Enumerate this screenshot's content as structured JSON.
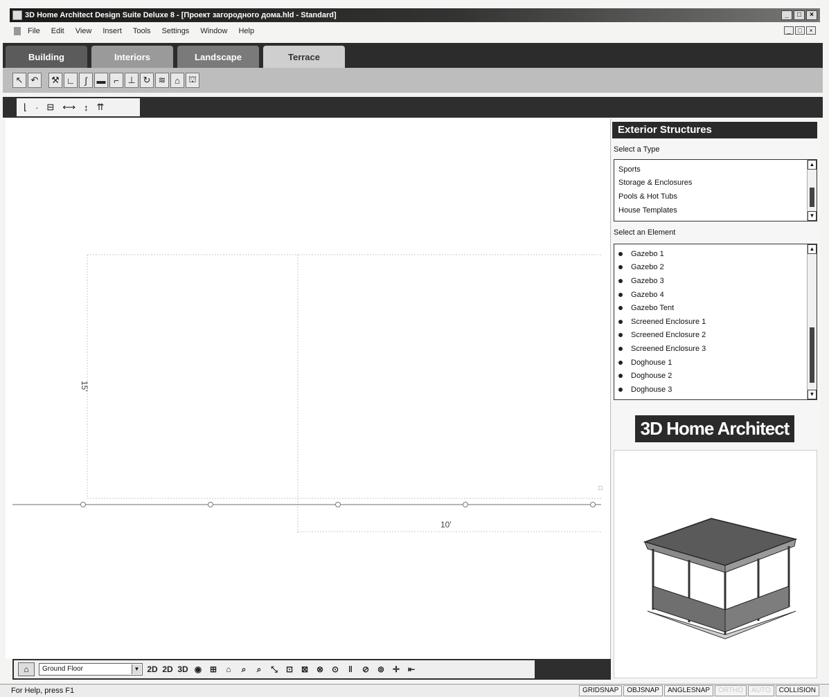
{
  "window": {
    "title": "3D Home Architect Design Suite Deluxe 8 - [Проект загородного дома.hld - Standard]",
    "controls": [
      "_",
      "□",
      "×"
    ],
    "mdi_controls": [
      "_",
      "□",
      "×"
    ]
  },
  "menu": [
    "File",
    "Edit",
    "View",
    "Insert",
    "Tools",
    "Settings",
    "Window",
    "Help"
  ],
  "tabs": [
    {
      "label": "Building"
    },
    {
      "label": "Interiors"
    },
    {
      "label": "Landscape"
    },
    {
      "label": "Terrace"
    }
  ],
  "toolbar1_icons": [
    "select-arrow-icon",
    "undo-arrow-icon",
    "shovel-icon",
    "path-icon",
    "brush-icon",
    "line-icon",
    "stairs-icon",
    "post-icon",
    "curve-icon",
    "terrain-icon",
    "structure-icon",
    "gazebo-icon"
  ],
  "toolbar2_icons": [
    "dimension-icon",
    "point-icon",
    "table-icon",
    "horizontal-measure-icon",
    "vertical-measure-icon",
    "double-arrow-icon"
  ],
  "canvas": {
    "dim_vertical": "15'",
    "dim_horizontal": "10'"
  },
  "viewbar": {
    "floor": "Ground Floor",
    "view_buttons": [
      "2D",
      "2D",
      "3D",
      "◉",
      "⊞",
      "⌂",
      "⌕",
      "⌕",
      "⤡",
      "⊡",
      "⊠",
      "⊗",
      "⊙",
      "‖",
      "⊘",
      "⊚",
      "✛",
      "⇤"
    ]
  },
  "status": {
    "help": "For Help, press F1",
    "panes": [
      {
        "label": "GRIDSNAP",
        "active": true
      },
      {
        "label": "OBJSNAP",
        "active": true
      },
      {
        "label": "ANGLESNAP",
        "active": true
      },
      {
        "label": "ORTHO",
        "active": false
      },
      {
        "label": "AUTO",
        "active": false
      },
      {
        "label": "COLLISION",
        "active": true
      }
    ]
  },
  "panel": {
    "title": "Exterior Structures",
    "type_label": "Select a Type",
    "types": [
      "Sports",
      "Storage & Enclosures",
      "Pools & Hot Tubs",
      "House Templates"
    ],
    "element_label": "Select an Element",
    "elements": [
      "Gazebo 1",
      "Gazebo 2",
      "Gazebo 3",
      "Gazebo 4",
      "Gazebo Tent",
      "Screened Enclosure 1",
      "Screened Enclosure 2",
      "Screened Enclosure 3",
      "Doghouse 1",
      "Doghouse 2",
      "Doghouse 3"
    ],
    "logo": "3D Home Architect"
  }
}
